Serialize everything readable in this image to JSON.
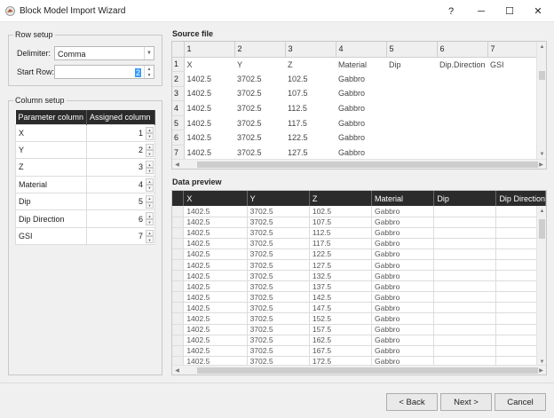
{
  "window": {
    "title": "Block Model Import Wizard",
    "help_label": "?",
    "minimize_label": "─",
    "maximize_label": "☐",
    "close_label": "✕"
  },
  "row_setup": {
    "title": "Row setup",
    "delimiter_label": "Delimiter:",
    "delimiter_value": "Comma",
    "start_row_label": "Start Row:",
    "start_row_value": "2"
  },
  "column_setup": {
    "title": "Column setup",
    "headers": [
      "Parameter column",
      "Assigned column"
    ],
    "rows": [
      {
        "param": "X",
        "col": "1"
      },
      {
        "param": "Y",
        "col": "2"
      },
      {
        "param": "Z",
        "col": "3"
      },
      {
        "param": "Material",
        "col": "4"
      },
      {
        "param": "Dip",
        "col": "5"
      },
      {
        "param": "Dip Direction",
        "col": "6"
      },
      {
        "param": "GSI",
        "col": "7"
      }
    ]
  },
  "source_file": {
    "title": "Source file",
    "columns": [
      "1",
      "2",
      "3",
      "4",
      "5",
      "6",
      "7"
    ],
    "rows": [
      {
        "n": "1",
        "cells": [
          "X",
          "Y",
          "Z",
          "Material",
          "Dip",
          "Dip.Direction",
          "GSI"
        ]
      },
      {
        "n": "2",
        "cells": [
          "1402.5",
          "3702.5",
          "102.5",
          "Gabbro",
          "",
          "",
          ""
        ]
      },
      {
        "n": "3",
        "cells": [
          "1402.5",
          "3702.5",
          "107.5",
          "Gabbro",
          "",
          "",
          ""
        ]
      },
      {
        "n": "4",
        "cells": [
          "1402.5",
          "3702.5",
          "112.5",
          "Gabbro",
          "",
          "",
          ""
        ]
      },
      {
        "n": "5",
        "cells": [
          "1402.5",
          "3702.5",
          "117.5",
          "Gabbro",
          "",
          "",
          ""
        ]
      },
      {
        "n": "6",
        "cells": [
          "1402.5",
          "3702.5",
          "122.5",
          "Gabbro",
          "",
          "",
          ""
        ]
      },
      {
        "n": "7",
        "cells": [
          "1402.5",
          "3702.5",
          "127.5",
          "Gabbro",
          "",
          "",
          ""
        ]
      }
    ]
  },
  "data_preview": {
    "title": "Data preview",
    "columns": [
      "X",
      "Y",
      "Z",
      "Material",
      "Dip",
      "Dip Direction"
    ],
    "rows": [
      [
        "1402.5",
        "3702.5",
        "102.5",
        "Gabbro",
        "",
        ""
      ],
      [
        "1402.5",
        "3702.5",
        "107.5",
        "Gabbro",
        "",
        ""
      ],
      [
        "1402.5",
        "3702.5",
        "112.5",
        "Gabbro",
        "",
        ""
      ],
      [
        "1402.5",
        "3702.5",
        "117.5",
        "Gabbro",
        "",
        ""
      ],
      [
        "1402.5",
        "3702.5",
        "122.5",
        "Gabbro",
        "",
        ""
      ],
      [
        "1402.5",
        "3702.5",
        "127.5",
        "Gabbro",
        "",
        ""
      ],
      [
        "1402.5",
        "3702.5",
        "132.5",
        "Gabbro",
        "",
        ""
      ],
      [
        "1402.5",
        "3702.5",
        "137.5",
        "Gabbro",
        "",
        ""
      ],
      [
        "1402.5",
        "3702.5",
        "142.5",
        "Gabbro",
        "",
        ""
      ],
      [
        "1402.5",
        "3702.5",
        "147.5",
        "Gabbro",
        "",
        ""
      ],
      [
        "1402.5",
        "3702.5",
        "152.5",
        "Gabbro",
        "",
        ""
      ],
      [
        "1402.5",
        "3702.5",
        "157.5",
        "Gabbro",
        "",
        ""
      ],
      [
        "1402.5",
        "3702.5",
        "162.5",
        "Gabbro",
        "",
        ""
      ],
      [
        "1402.5",
        "3702.5",
        "167.5",
        "Gabbro",
        "",
        ""
      ],
      [
        "1402.5",
        "3702.5",
        "172.5",
        "Gabbro",
        "",
        ""
      ]
    ]
  },
  "buttons": {
    "back": "< Back",
    "next": "Next >",
    "cancel": "Cancel"
  }
}
